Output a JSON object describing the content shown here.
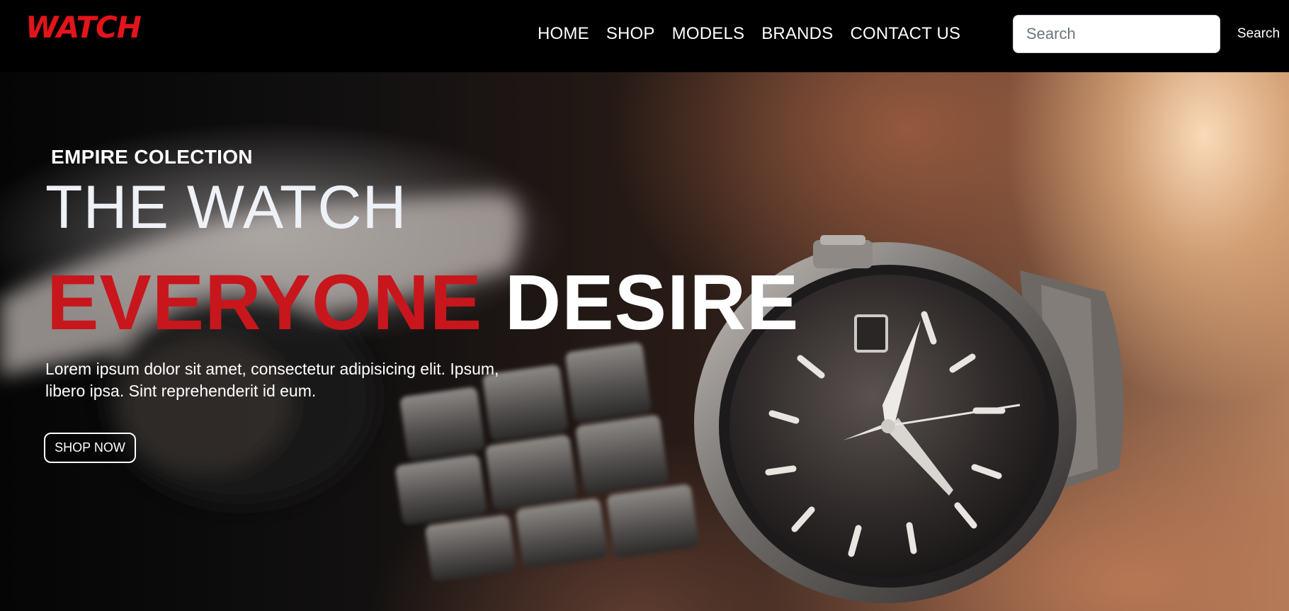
{
  "brand": {
    "logo_text": "WATCH"
  },
  "nav": {
    "links": [
      "HOME",
      "SHOP",
      "MODELS",
      "BRANDS",
      "CONTACT US"
    ]
  },
  "search": {
    "placeholder": "Search",
    "button_label": "Search"
  },
  "hero": {
    "eyebrow": "EMPIRE COLECTION",
    "headline_line1": "THE WATCH",
    "headline_red": "EVERYONE",
    "headline_white": "DESIRE",
    "description": "Lorem ipsum dolor sit amet, consectetur adipisicing elit. Ipsum, libero ipsa. Sint reprehenderit id eum.",
    "cta_label": "SHOP NOW"
  },
  "colors": {
    "brand_red": "#e3141b",
    "headline_red": "#c8161d",
    "nav_background": "#000000",
    "text": "#ffffff"
  },
  "icons": {
    "hero_image": "wristwatch-photo"
  }
}
